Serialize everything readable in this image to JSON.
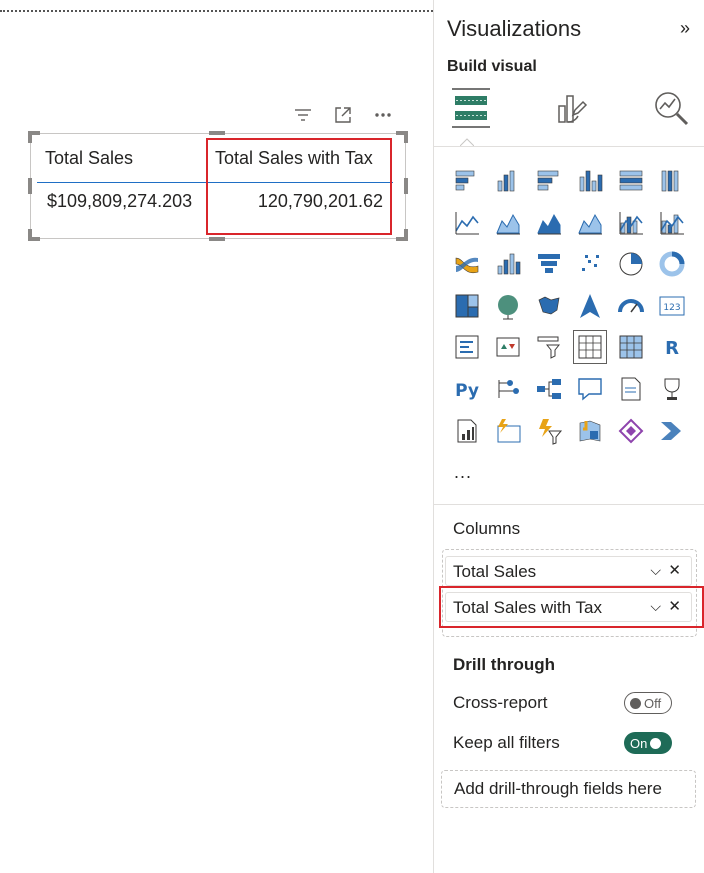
{
  "canvas": {
    "visual_header_icons": [
      "filter-icon",
      "focus-mode-icon",
      "more-options-icon"
    ],
    "table": {
      "columns": [
        "Total Sales",
        "Total Sales with Tax"
      ],
      "row": [
        "$109,809,274.203",
        "120,790,201.62"
      ]
    }
  },
  "pane": {
    "title": "Visualizations",
    "collapse_glyph": "»",
    "build_visual_label": "Build visual",
    "tabs": [
      "build-visual-icon",
      "format-visual-icon",
      "analytics-icon"
    ],
    "more_visuals": "...",
    "columns_label": "Columns",
    "fields": [
      {
        "label": "Total Sales"
      },
      {
        "label": "Total Sales with Tax"
      }
    ],
    "drill_through_title": "Drill through",
    "cross_report": {
      "label": "Cross-report",
      "state": "Off"
    },
    "keep_all_filters": {
      "label": "Keep all filters",
      "state": "On"
    },
    "add_drill_through": "Add drill-through fields here",
    "visual_types": [
      "stacked-bar-chart-icon",
      "stacked-column-chart-icon",
      "clustered-bar-chart-icon",
      "clustered-column-chart-icon",
      "100-stacked-bar-chart-icon",
      "100-stacked-column-chart-icon",
      "line-chart-icon",
      "area-chart-icon",
      "stacked-area-chart-icon",
      "100-stacked-area-chart-icon",
      "line-and-stacked-column-chart-icon",
      "line-and-clustered-column-chart-icon",
      "ribbon-chart-icon",
      "waterfall-chart-icon",
      "funnel-chart-icon",
      "scatter-chart-icon",
      "pie-chart-icon",
      "donut-chart-icon",
      "treemap-icon",
      "map-icon",
      "filled-map-icon",
      "azure-map-icon",
      "gauge-icon",
      "card-icon",
      "multi-row-card-icon",
      "kpi-icon",
      "slicer-icon",
      "table-icon",
      "matrix-icon",
      "r-visual-icon",
      "python-visual-icon",
      "key-influencers-icon",
      "decomposition-tree-icon",
      "qa-icon",
      "smart-narrative-icon",
      "metrics-icon",
      "paginated-report-icon",
      "azure-card-icon",
      "power-automate-icon",
      "arcgis-map-icon",
      "power-apps-icon",
      "power-automate-arrow-icon"
    ],
    "selected_visual": "table-icon",
    "colors": {
      "accent_green": "#1e6b57",
      "highlight_red": "#d9252b",
      "selection_blue": "#1f6fc5"
    }
  }
}
